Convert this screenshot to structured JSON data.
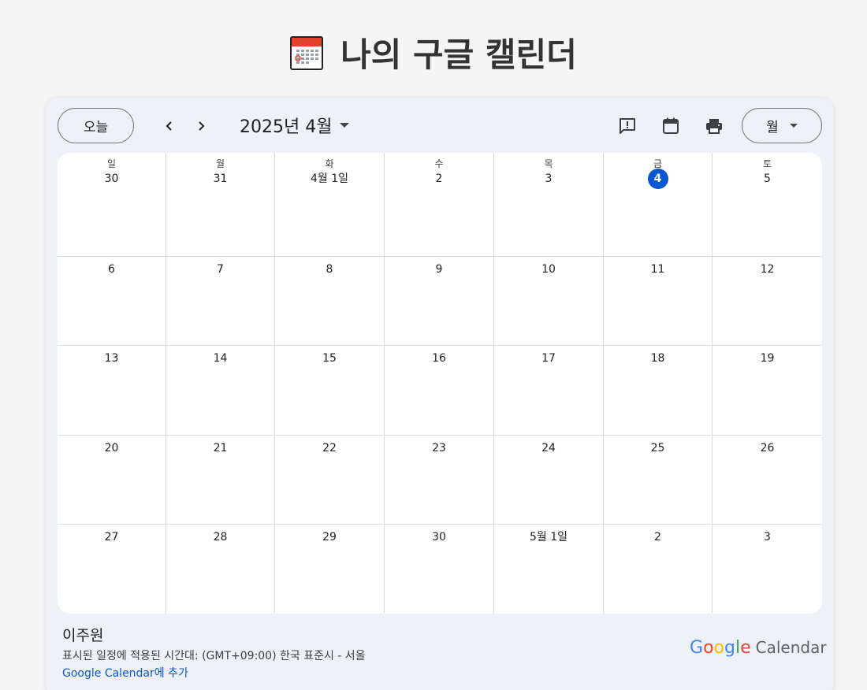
{
  "page": {
    "title": "나의 구글 캘린더",
    "title_icon": "calendar-emoji-icon"
  },
  "toolbar": {
    "today_label": "오늘",
    "month_label": "2025년 4월",
    "view_label": "월",
    "icons": [
      "chevron-left-icon",
      "chevron-right-icon",
      "feedback-icon",
      "calendar-icon",
      "print-icon"
    ]
  },
  "calendar": {
    "weekdays": [
      "일",
      "월",
      "화",
      "수",
      "목",
      "금",
      "토"
    ],
    "weeks": [
      [
        "30",
        "31",
        "4월 1일",
        "2",
        "3",
        "4",
        "5"
      ],
      [
        "6",
        "7",
        "8",
        "9",
        "10",
        "11",
        "12"
      ],
      [
        "13",
        "14",
        "15",
        "16",
        "17",
        "18",
        "19"
      ],
      [
        "20",
        "21",
        "22",
        "23",
        "24",
        "25",
        "26"
      ],
      [
        "27",
        "28",
        "29",
        "30",
        "5월 1일",
        "2",
        "3"
      ]
    ],
    "today": "4"
  },
  "footer": {
    "user": "이주원",
    "timezone": "표시된 일정에 적용된 시간대: (GMT+09:00) 한국 표준시 - 서울",
    "add_link": "Google Calendar에 추가",
    "logo_google": [
      "G",
      "o",
      "o",
      "g",
      "l",
      "e"
    ],
    "logo_calendar": "Calendar"
  },
  "colors": {
    "accent": "#0b57d0",
    "google_blue": "#4285f4",
    "google_red": "#ea4335",
    "google_yellow": "#fbbc05",
    "google_green": "#34a853"
  }
}
